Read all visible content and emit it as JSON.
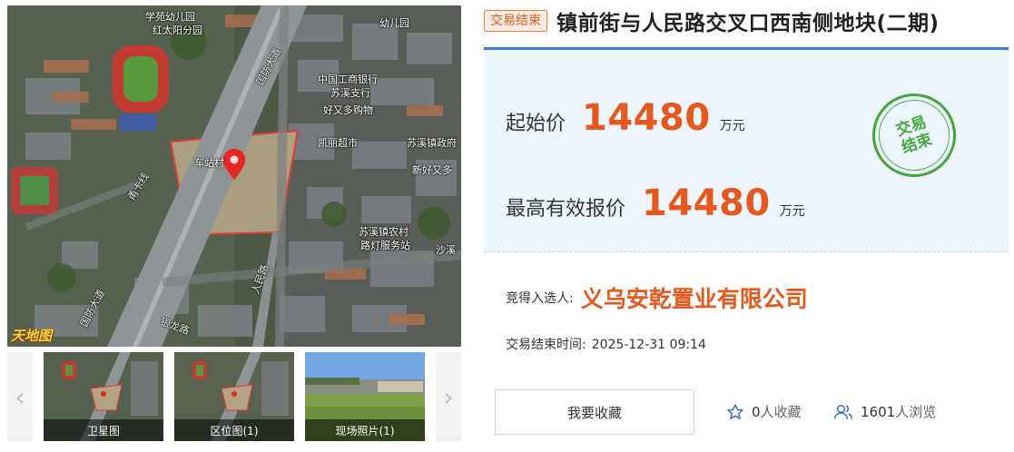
{
  "gallery": {
    "map_brand": "天地图",
    "map_labels": [
      {
        "id": "kindergarten",
        "text": "学苑幼儿园"
      },
      {
        "id": "kindergarten-branch",
        "text": "红太阳分园"
      },
      {
        "id": "youeryuan",
        "text": "幼儿园"
      },
      {
        "id": "guofang-road-top",
        "text": "国防大道"
      },
      {
        "id": "icbc",
        "text": "中国工商银行"
      },
      {
        "id": "icbc-branch",
        "text": "苏溪支行"
      },
      {
        "id": "haoyouduo",
        "text": "好又多购物"
      },
      {
        "id": "kaili",
        "text": "凯丽超市"
      },
      {
        "id": "suxi-zhen",
        "text": "苏溪镇政府"
      },
      {
        "id": "chezhan",
        "text": "车站村"
      },
      {
        "id": "xinhao",
        "text": "新好又多"
      },
      {
        "id": "suxi-village",
        "text": "苏溪镇农村"
      },
      {
        "id": "service",
        "text": "路灯服务站"
      },
      {
        "id": "shaxi",
        "text": "沙溪"
      },
      {
        "id": "renmin-road",
        "text": "人民路"
      },
      {
        "id": "guofang-road-bottom",
        "text": "国防大道"
      },
      {
        "id": "yinlong-road",
        "text": "银龙路"
      },
      {
        "id": "yinlong-line",
        "text": "甬卡线"
      }
    ],
    "thumbnails": [
      {
        "caption": "卫星图"
      },
      {
        "caption": "区位图(1)"
      },
      {
        "caption": "现场照片(1)"
      }
    ],
    "prev_arrow": "‹",
    "next_arrow": "›"
  },
  "header": {
    "status_tag": "交易结束",
    "title": "镇前街与人民路交叉口西南侧地块(二期)"
  },
  "pricing": {
    "start_label": "起始价",
    "start_value": "14480",
    "start_unit": "万元",
    "best_label": "最高有效报价",
    "best_value": "14480",
    "best_unit": "万元",
    "stamp_line1": "交易",
    "stamp_line2": "结束"
  },
  "result": {
    "winner_label": "竞得入选人:",
    "winner_name": "义乌安乾置业有限公司",
    "end_time_label": "交易结束时间:",
    "end_time_value": "2025-12-31 09:14"
  },
  "actions": {
    "favorite_button": "我要收藏",
    "favorite_count": "0",
    "favorite_suffix": "人收藏",
    "view_count": "1601",
    "view_suffix": "人浏览"
  },
  "colors": {
    "accent_orange": "#e8581c",
    "accent_blue": "#3b7fd8",
    "stamp_green": "#46a63a",
    "card_bg": "#edf5fd"
  },
  "icons": {
    "favorite": "star-icon",
    "views": "users-icon",
    "map_pin": "map-pin-icon"
  }
}
